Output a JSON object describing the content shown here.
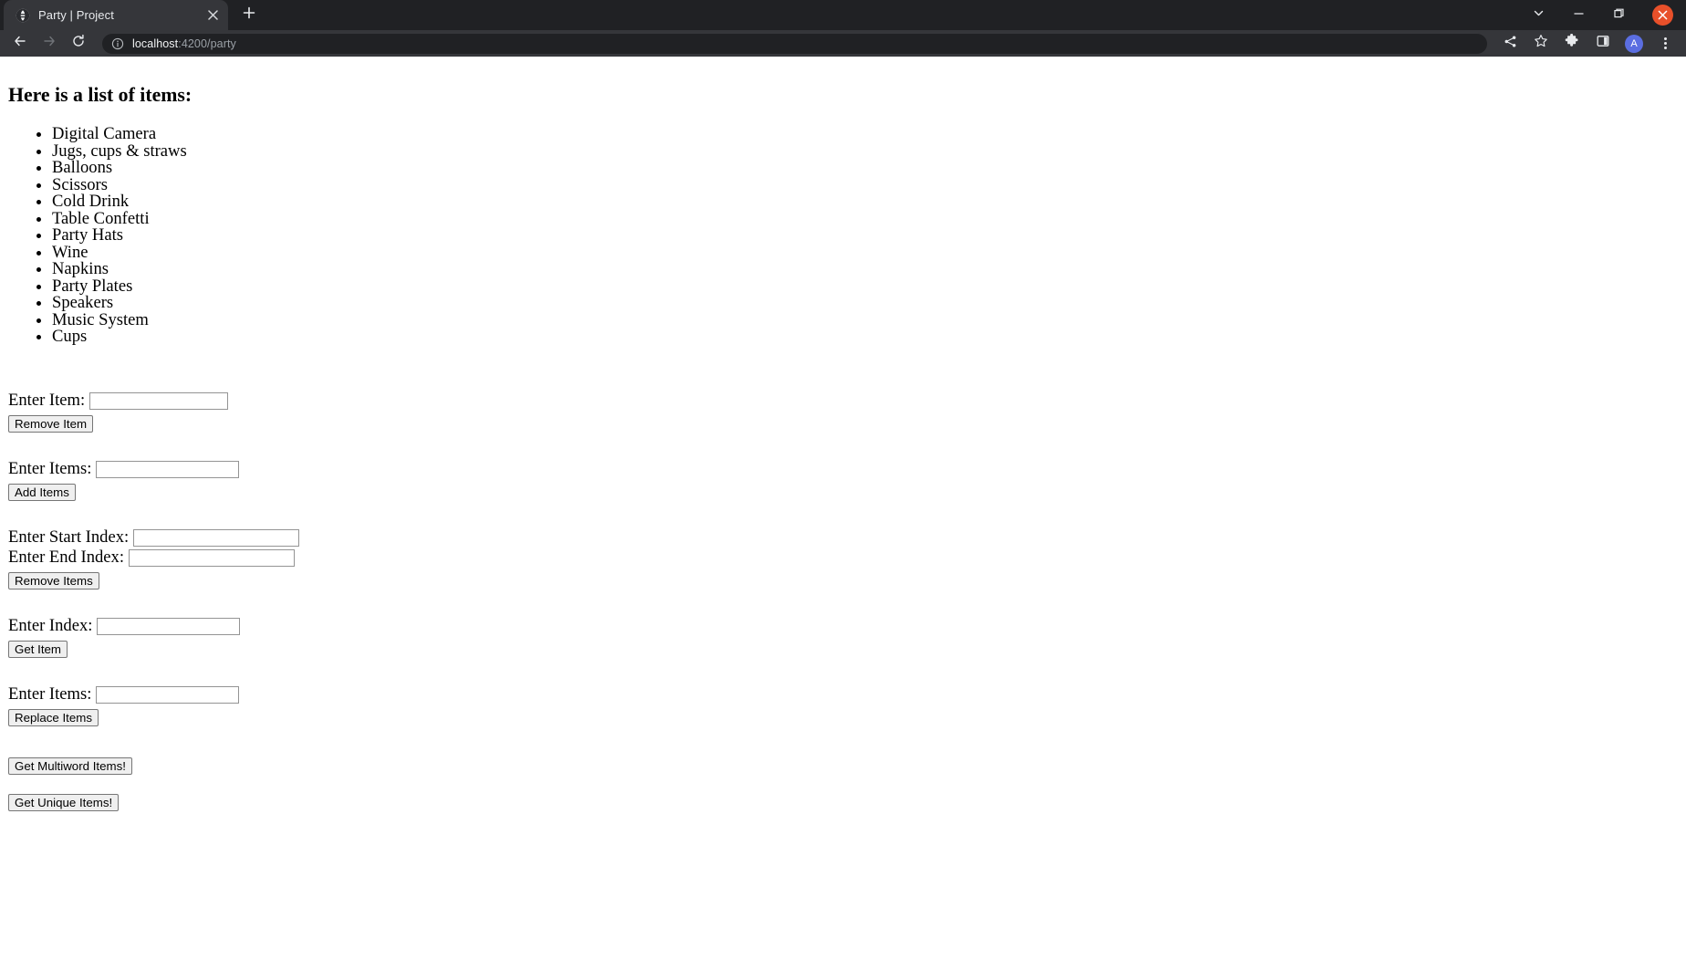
{
  "browser": {
    "tab": {
      "title": "Party | Project",
      "favicon_icon": "globe-icon",
      "close_icon": "close-icon"
    },
    "new_tab_icon": "plus-icon",
    "window_controls": {
      "tab_search_icon": "chevron-down-icon",
      "minimize_icon": "minimize-icon",
      "maximize_icon": "maximize-icon",
      "close_icon": "close-icon"
    },
    "nav": {
      "back_icon": "back-arrow-icon",
      "forward_icon": "forward-arrow-icon",
      "reload_icon": "reload-icon"
    },
    "omnibox": {
      "info_icon": "info-circle-icon",
      "url_host": "localhost",
      "url_rest": ":4200/party",
      "url_full": "localhost:4200/party"
    },
    "toolbar_icons": {
      "share_icon": "share-icon",
      "bookmark_icon": "star-icon",
      "extensions_icon": "puzzle-icon",
      "side_panel_icon": "side-panel-icon",
      "profile_initial": "A",
      "menu_icon": "three-dots-icon"
    },
    "colors": {
      "chrome_bg": "#202124",
      "toolbar_bg": "#35363a",
      "close_button": "#e8502a",
      "avatar": "#5b6ee1"
    }
  },
  "page": {
    "heading": "Here is a list of items:",
    "items": [
      "Digital Camera",
      "Jugs, cups & straws",
      "Balloons",
      "Scissors",
      "Cold Drink",
      "Table Confetti",
      "Party Hats",
      "Wine",
      "Napkins",
      "Party Plates",
      "Speakers",
      "Music System",
      "Cups"
    ],
    "forms": {
      "remove_item": {
        "label": "Enter Item:",
        "input_value": "",
        "input_placeholder": "",
        "button": "Remove Item"
      },
      "add_items": {
        "label": "Enter Items:",
        "input_value": "",
        "input_placeholder": "",
        "button": "Add Items"
      },
      "remove_items": {
        "start_label": "Enter Start Index:",
        "start_value": "",
        "end_label": "Enter End Index:",
        "end_value": "",
        "button": "Remove Items"
      },
      "get_item": {
        "label": "Enter Index:",
        "input_value": "",
        "input_placeholder": "",
        "button": "Get Item"
      },
      "replace_items": {
        "label": "Enter Items:",
        "input_value": "",
        "input_placeholder": "",
        "button": "Replace Items"
      },
      "multiword_button": "Get Multiword Items!",
      "unique_button": "Get Unique Items!"
    }
  }
}
